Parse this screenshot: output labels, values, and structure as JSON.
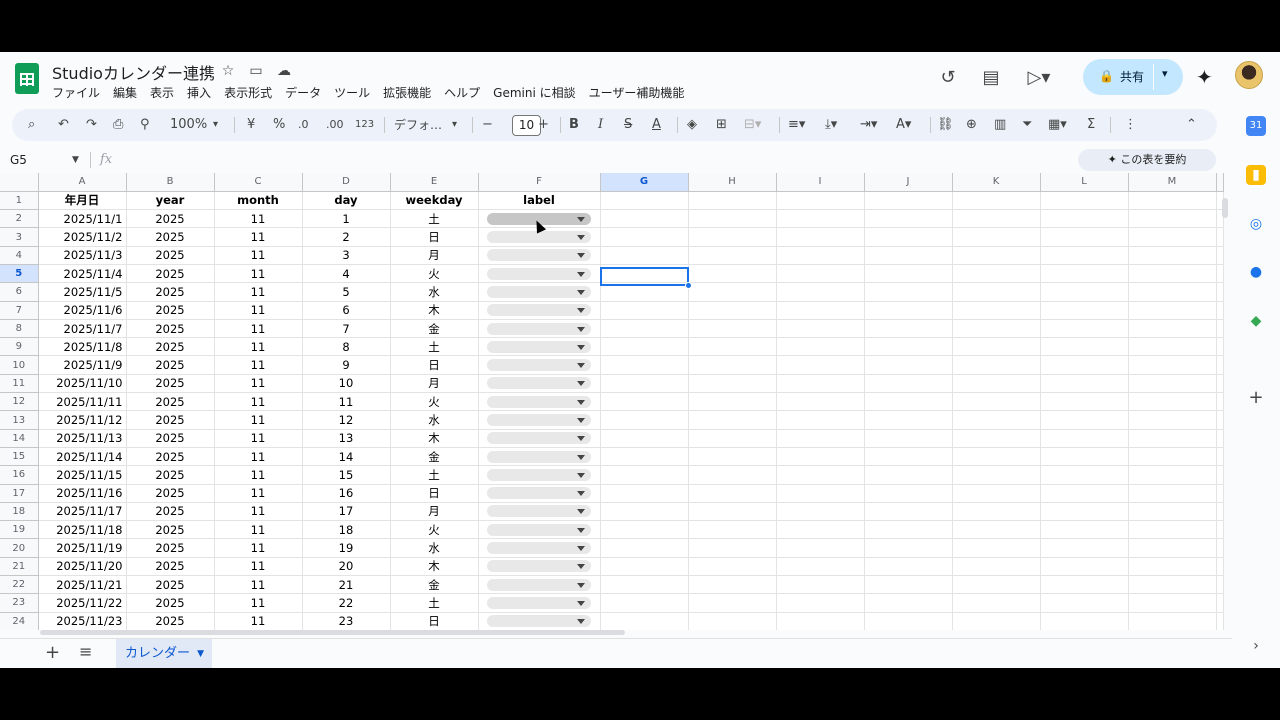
{
  "doc": {
    "title": "Studioカレンダー連携"
  },
  "menu": [
    "ファイル",
    "編集",
    "表示",
    "挿入",
    "表示形式",
    "データ",
    "ツール",
    "拡張機能",
    "ヘルプ",
    "Gemini に相談",
    "ユーザー補助機能"
  ],
  "header": {
    "share_label": "共有"
  },
  "toolbar": {
    "zoom": "100%",
    "currency": "¥",
    "percent": "%",
    "dec_minus": ".0",
    "dec_plus": ".00",
    "number_format": "123",
    "font": "デフォ…",
    "font_size": "10"
  },
  "formula_bar": {
    "name_box": "G5",
    "summarize_label": "この表を要約"
  },
  "sheet": {
    "columns": [
      "A",
      "B",
      "C",
      "D",
      "E",
      "F",
      "G",
      "H",
      "I",
      "J",
      "K",
      "L",
      "M"
    ],
    "selected_column": "G",
    "selected_row": 5,
    "headers": [
      "年月日",
      "year",
      "month",
      "day",
      "weekday",
      "label"
    ],
    "rows": [
      [
        "2025/11/1",
        "2025",
        "11",
        "1",
        "土"
      ],
      [
        "2025/11/2",
        "2025",
        "11",
        "2",
        "日"
      ],
      [
        "2025/11/3",
        "2025",
        "11",
        "3",
        "月"
      ],
      [
        "2025/11/4",
        "2025",
        "11",
        "4",
        "火"
      ],
      [
        "2025/11/5",
        "2025",
        "11",
        "5",
        "水"
      ],
      [
        "2025/11/6",
        "2025",
        "11",
        "6",
        "木"
      ],
      [
        "2025/11/7",
        "2025",
        "11",
        "7",
        "金"
      ],
      [
        "2025/11/8",
        "2025",
        "11",
        "8",
        "土"
      ],
      [
        "2025/11/9",
        "2025",
        "11",
        "9",
        "日"
      ],
      [
        "2025/11/10",
        "2025",
        "11",
        "10",
        "月"
      ],
      [
        "2025/11/11",
        "2025",
        "11",
        "11",
        "火"
      ],
      [
        "2025/11/12",
        "2025",
        "11",
        "12",
        "水"
      ],
      [
        "2025/11/13",
        "2025",
        "11",
        "13",
        "木"
      ],
      [
        "2025/11/14",
        "2025",
        "11",
        "14",
        "金"
      ],
      [
        "2025/11/15",
        "2025",
        "11",
        "15",
        "土"
      ],
      [
        "2025/11/16",
        "2025",
        "11",
        "16",
        "日"
      ],
      [
        "2025/11/17",
        "2025",
        "11",
        "17",
        "月"
      ],
      [
        "2025/11/18",
        "2025",
        "11",
        "18",
        "火"
      ],
      [
        "2025/11/19",
        "2025",
        "11",
        "19",
        "水"
      ],
      [
        "2025/11/20",
        "2025",
        "11",
        "20",
        "木"
      ],
      [
        "2025/11/21",
        "2025",
        "11",
        "21",
        "金"
      ],
      [
        "2025/11/22",
        "2025",
        "11",
        "22",
        "土"
      ],
      [
        "2025/11/23",
        "2025",
        "11",
        "23",
        "日"
      ]
    ]
  },
  "sheet_tab": {
    "label": "カレンダー"
  },
  "colors": {
    "selection": "#1a73e8",
    "share_bg": "#c2e7ff",
    "tab_active": "#e1e9f7"
  }
}
